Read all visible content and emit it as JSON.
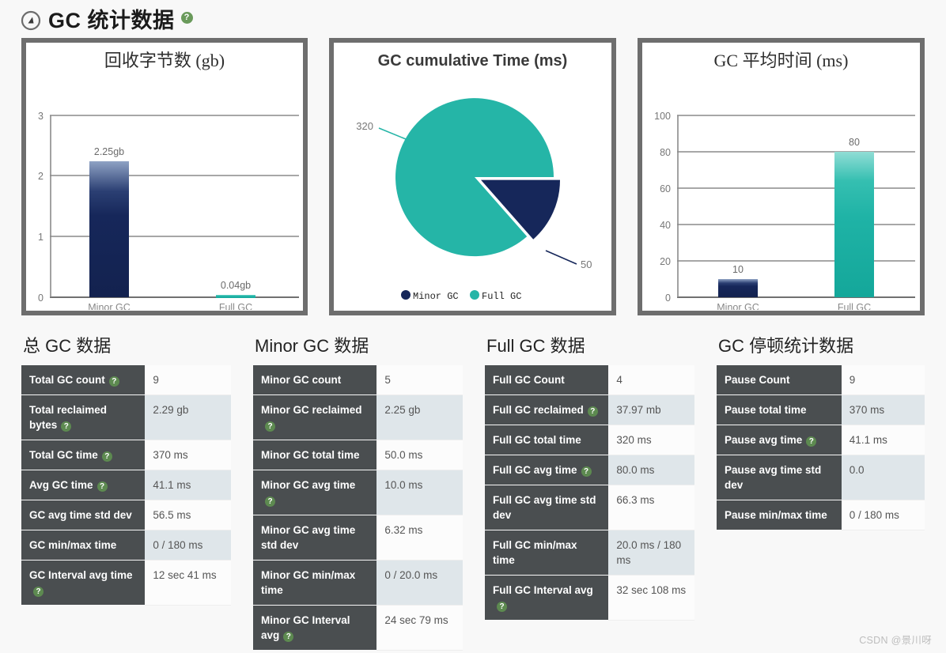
{
  "header": {
    "icon": "compass-icon",
    "title": "GC 统计数据",
    "help": "?"
  },
  "charts": [
    {
      "id": "reclaimed-bytes-chart",
      "title": "回收字节数 (gb)",
      "type": "bar"
    },
    {
      "id": "gc-cumulative-time-chart",
      "title": "GC cumulative Time (ms)",
      "type": "pie"
    },
    {
      "id": "gc-avg-time-chart",
      "title": "GC 平均时间 (ms)",
      "type": "bar"
    }
  ],
  "chart_data": [
    {
      "type": "bar",
      "title": "回收字节数 (gb)",
      "categories": [
        "Minor GC",
        "Full GC"
      ],
      "values": [
        2.25,
        0.04
      ],
      "data_labels": [
        "2.25gb",
        "0.04gb"
      ],
      "colors": [
        "#16275a",
        "#1fb3a6"
      ],
      "xlabel": "",
      "ylabel": "",
      "ylim": [
        0,
        3
      ],
      "yticks": [
        0,
        1,
        2,
        3
      ],
      "ytick_labels": [
        "0",
        "1",
        "2",
        "3"
      ],
      "grid": true,
      "legend": false
    },
    {
      "type": "pie",
      "title": "GC cumulative Time (ms)",
      "categories": [
        "Minor GC",
        "Full GC"
      ],
      "values": [
        50,
        320
      ],
      "data_labels": [
        "50",
        "320"
      ],
      "colors": [
        "#16275a",
        "#25b5a7"
      ],
      "exploded": [
        "Minor GC"
      ],
      "legend": true,
      "legend_position": "bottom",
      "legend_entries": [
        "Minor GC",
        "Full GC"
      ]
    },
    {
      "type": "bar",
      "title": "GC 平均时间 (ms)",
      "categories": [
        "Minor GC",
        "Full GC"
      ],
      "values": [
        10,
        80
      ],
      "data_labels": [
        "10",
        "80"
      ],
      "colors": [
        "#16275a",
        "#25b5a7"
      ],
      "xlabel": "",
      "ylabel": "",
      "ylim": [
        0,
        100
      ],
      "yticks": [
        0,
        20,
        40,
        60,
        80,
        100
      ],
      "ytick_labels": [
        "0",
        "20",
        "40",
        "60",
        "80",
        "100"
      ],
      "grid": true,
      "legend": false
    }
  ],
  "tables": [
    {
      "id": "total-gc-table",
      "title": "总 GC 数据",
      "rows": [
        {
          "label": "Total GC count",
          "help": true,
          "value": "9"
        },
        {
          "label": "Total reclaimed bytes",
          "help": true,
          "value": "2.29 gb"
        },
        {
          "label": "Total GC time",
          "help": true,
          "value": "370 ms"
        },
        {
          "label": "Avg GC time",
          "help": true,
          "value": "41.1 ms"
        },
        {
          "label": "GC avg time std dev",
          "help": false,
          "value": "56.5 ms"
        },
        {
          "label": "GC min/max time",
          "help": false,
          "value": "0 / 180 ms"
        },
        {
          "label": "GC Interval avg time",
          "help": true,
          "value": "12 sec 41 ms"
        }
      ]
    },
    {
      "id": "minor-gc-table",
      "title": "Minor GC 数据",
      "rows": [
        {
          "label": "Minor GC count",
          "help": false,
          "value": "5"
        },
        {
          "label": "Minor GC reclaimed",
          "help": true,
          "value": "2.25 gb"
        },
        {
          "label": "Minor GC total time",
          "help": false,
          "value": "50.0 ms"
        },
        {
          "label": "Minor GC avg time",
          "help": true,
          "value": "10.0 ms"
        },
        {
          "label": "Minor GC avg time std dev",
          "help": false,
          "value": "6.32 ms"
        },
        {
          "label": "Minor GC min/max time",
          "help": false,
          "value": "0 / 20.0 ms"
        },
        {
          "label": "Minor GC Interval avg",
          "help": true,
          "value": "24 sec 79 ms"
        }
      ]
    },
    {
      "id": "full-gc-table",
      "title": "Full GC 数据",
      "rows": [
        {
          "label": "Full GC Count",
          "help": false,
          "value": "4"
        },
        {
          "label": "Full GC reclaimed",
          "help": true,
          "value": "37.97 mb"
        },
        {
          "label": "Full GC total time",
          "help": false,
          "value": "320 ms"
        },
        {
          "label": "Full GC avg time",
          "help": true,
          "value": "80.0 ms"
        },
        {
          "label": "Full GC avg time std dev",
          "help": false,
          "value": "66.3 ms"
        },
        {
          "label": "Full GC min/max time",
          "help": false,
          "value": "20.0 ms / 180 ms"
        },
        {
          "label": "Full GC Interval avg",
          "help": true,
          "value": "32 sec 108 ms"
        }
      ]
    },
    {
      "id": "pause-stats-table",
      "title": "GC 停顿统计数据",
      "rows": [
        {
          "label": "Pause Count",
          "help": false,
          "value": "9"
        },
        {
          "label": "Pause total time",
          "help": false,
          "value": "370 ms"
        },
        {
          "label": "Pause avg time",
          "help": true,
          "value": "41.1 ms"
        },
        {
          "label": "Pause avg time std dev",
          "help": false,
          "value": "0.0"
        },
        {
          "label": "Pause min/max time",
          "help": false,
          "value": "0 / 180 ms"
        }
      ]
    }
  ],
  "watermark": "CSDN @景川呀"
}
